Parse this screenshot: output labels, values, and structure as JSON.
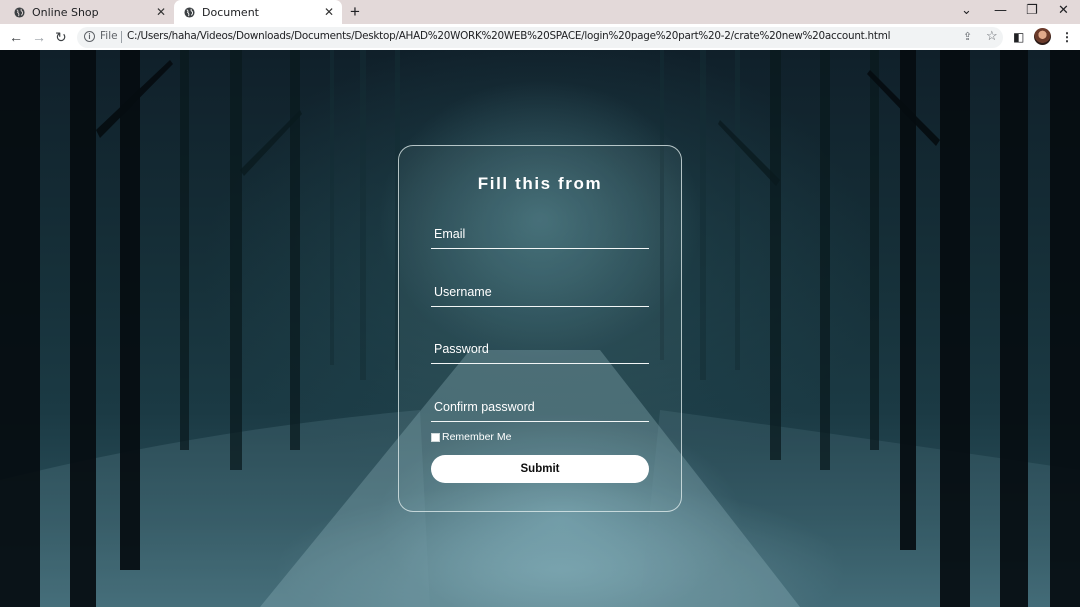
{
  "browser": {
    "tabs": [
      {
        "title": "Online Shop",
        "active": false
      },
      {
        "title": "Document",
        "active": true
      }
    ],
    "new_tab_icon": "plus-icon",
    "address": {
      "scheme_label": "File",
      "url": "C:/Users/haha/Videos/Downloads/Documents/Desktop/AHAD%20WORK%20WEB%20SPACE/login%20page%20part%20-2/crate%20new%20account.html"
    }
  },
  "form": {
    "title": "Fill this from",
    "fields": {
      "email_placeholder": "Email",
      "username_placeholder": "Username",
      "password_placeholder": "Password",
      "confirm_placeholder": "Confirm password"
    },
    "remember_label": "Remember Me",
    "remember_checked": false,
    "submit_label": "Submit"
  },
  "colors": {
    "tabstrip": "#e3d9d9",
    "card_border": "#e6f0f0",
    "submit_bg": "#ffffff"
  }
}
